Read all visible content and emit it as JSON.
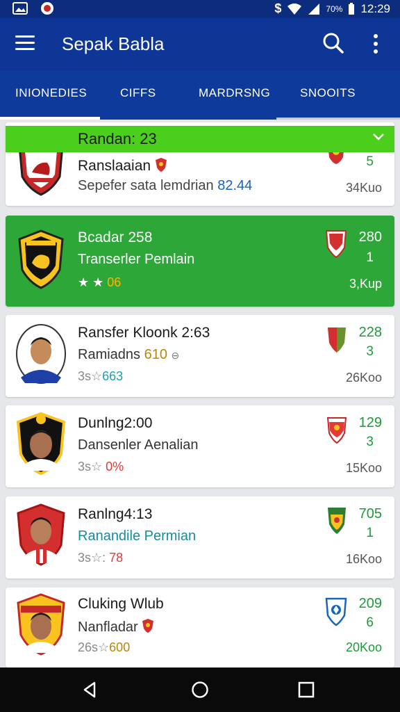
{
  "status": {
    "time": "12:29",
    "battery": "70%",
    "dollar": "$"
  },
  "app": {
    "title": "Sepak Babla"
  },
  "tabs": [
    "INIONEDIES",
    "CIFFS",
    "MARDRSNG",
    "SNOOITS"
  ],
  "banner": {
    "text": "Randan: 23"
  },
  "cards": [
    {
      "name": "Ranslaaian",
      "sub": "Sepefer sata lemdrian",
      "sub_value": "82.44",
      "top": "5",
      "dist": "34Kuo",
      "badge_color": "#c62828",
      "flag_color": "#d32f2f"
    },
    {
      "name": "Bcadar 258",
      "sub": "Transerler Pemlain",
      "stars": "★ ★",
      "stars_value": "06",
      "top": "280",
      "bottom": "1",
      "dist": "3,Kup",
      "badge_color": "#f9c31f",
      "flag_color": "#d32f2f"
    },
    {
      "name": "Ransfer Kloonk 2:63",
      "sub": "Ramiadns",
      "sub_value": "610",
      "meta": "3s☆",
      "meta_value": "663",
      "top": "228",
      "bottom": "3",
      "dist": "26Koo",
      "flag_color": "#2e7d32"
    },
    {
      "name": "Dunlng2:00",
      "sub": "Dansenler Aenalian",
      "meta": "3s☆",
      "meta_value": "0%",
      "top": "129",
      "bottom": "3",
      "dist": "15Koo",
      "flag_color": "#e53935"
    },
    {
      "name": "Ranlng4:13",
      "sub": "Ranandile Permian",
      "meta": "3s☆:",
      "meta_value": "78",
      "top": "705",
      "bottom": "1",
      "dist": "16Koo",
      "flag_color": "#2e7d32"
    },
    {
      "name": "Cluking Wlub",
      "sub": "Nanfladar",
      "meta": "26s☆",
      "meta_value": "600",
      "top": "209",
      "bottom": "6",
      "dist": "20Koo",
      "flag_color": "#1565c0"
    }
  ]
}
